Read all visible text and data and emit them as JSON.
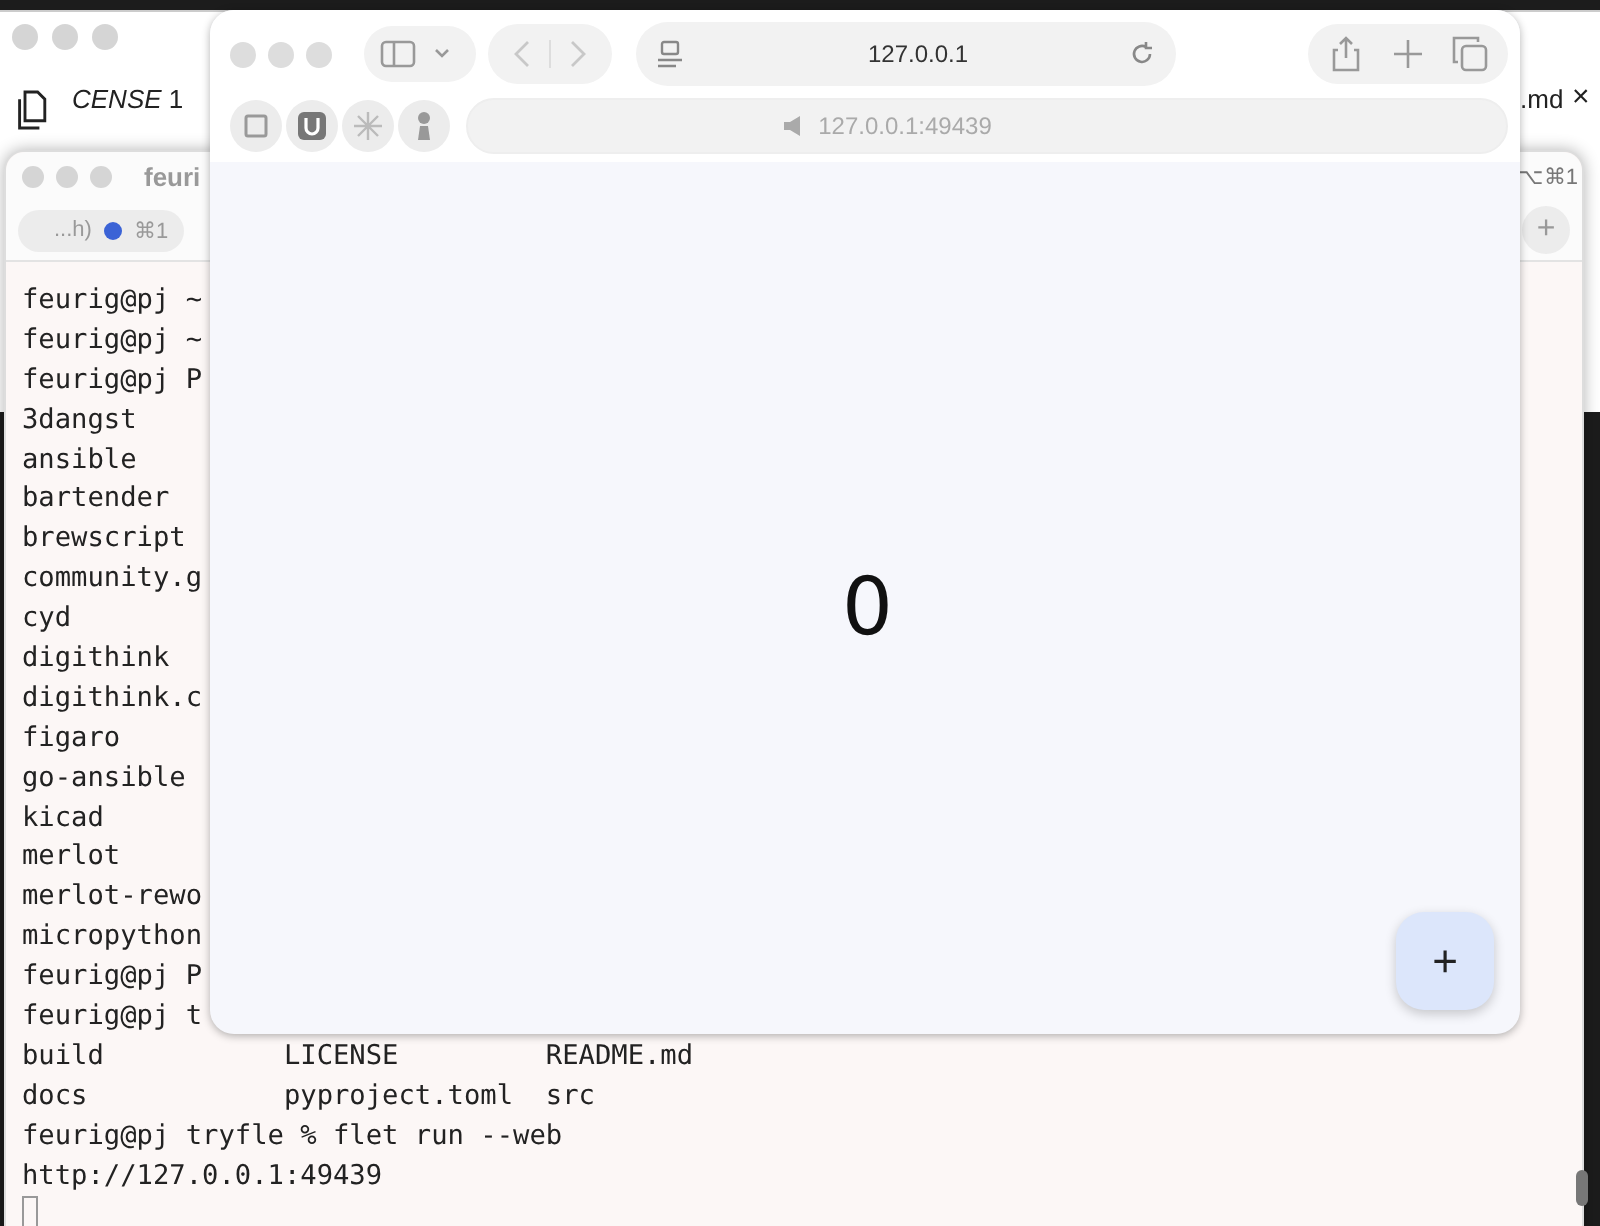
{
  "editor_window": {
    "tab_left": "CENSE",
    "tab_left_badge": "1",
    "tab_right": ".md",
    "close_glyph": "×"
  },
  "terminal": {
    "title": "feuri",
    "tab": {
      "label": "...h)",
      "shortcut": "⌘1"
    },
    "shortcut_right": "⌥⌘1",
    "new_tab": "+",
    "lines": [
      "feurig@pj ~",
      "feurig@pj ~",
      "feurig@pj P",
      "3dangst",
      "ansible",
      "bartender",
      "brewscript",
      "community.g",
      "cyd",
      "digithink",
      "digithink.c",
      "figaro",
      "go-ansible",
      "kicad",
      "merlot",
      "merlot-rewo",
      "micropython",
      "feurig@pj P",
      "feurig@pj t",
      "build           LICENSE         README.md",
      "docs            pyproject.toml  src",
      "feurig@pj tryfle % flet run --web",
      "http://127.0.0.1:49439"
    ]
  },
  "browser": {
    "address": "127.0.0.1",
    "page_url": "127.0.0.1:49439",
    "counter": "0",
    "fab": "+"
  }
}
